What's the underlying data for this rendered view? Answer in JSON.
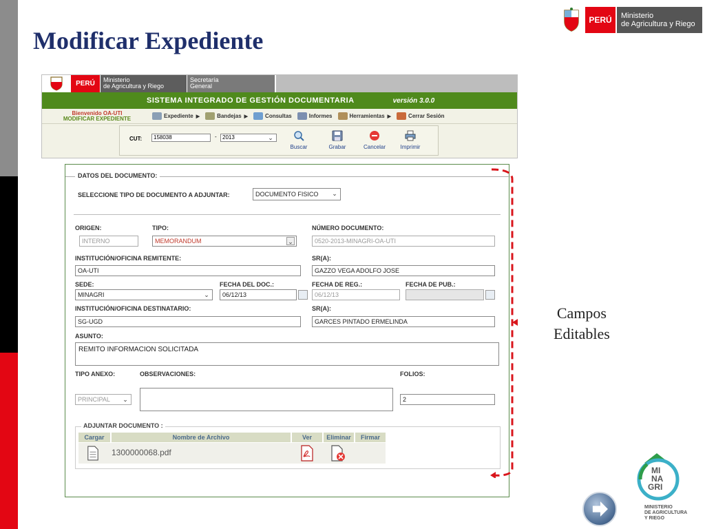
{
  "slide": {
    "title": "Modificar Expediente",
    "annotation": [
      "Campos",
      "Editables"
    ]
  },
  "brand": {
    "peru": "PERÚ",
    "ministry_line1": "Ministerio",
    "ministry_line2": "de Agricultura y Riego"
  },
  "app": {
    "peru": "PERÚ",
    "ministry_line1": "Ministerio",
    "ministry_line2": "de Agricultura y Riego",
    "secretaria_line1": "Secretaría",
    "secretaria_line2": "General",
    "system_title": "SISTEMA INTEGRADO DE GESTIÓN DOCUMENTARIA",
    "version": "versión 3.0.0",
    "welcome": "Bienvenido OA-UTI",
    "section": "Modificar Expediente",
    "menu": [
      "Expediente",
      "Bandejas",
      "Consultas",
      "Informes",
      "Herramientas",
      "Cerrar Sesión"
    ],
    "cut_label": "CUT:",
    "cut_value": "158038",
    "year_value": "2013",
    "dash": "-",
    "tools": [
      "Buscar",
      "Grabar",
      "Cancelar",
      "Imprimir"
    ]
  },
  "form": {
    "legend": "DATOS DEL DOCUMENTO:",
    "tipo_doc_label": "SELECCIONE TIPO DE DOCUMENTO A ADJUNTAR:",
    "tipo_doc_value": "DOCUMENTO FISICO",
    "origen_label": "ORIGEN:",
    "origen_value": "INTERNO",
    "tipo_label": "TIPO:",
    "tipo_value": "MEMORANDUM",
    "numero_label": "NÚMERO DOCUMENTO:",
    "numero_value": "0520-2013-MINAGRI-OA-UTI",
    "remitente_label": "INSTITUCIÓN/OFICINA REMITENTE:",
    "remitente_value": "OA-UTI",
    "sr1_label": "SR(A):",
    "sr1_value": "GAZZO VEGA ADOLFO JOSE",
    "sede_label": "SEDE:",
    "sede_value": "MINAGRI",
    "fecha_doc_label": "FECHA DEL DOC.:",
    "fecha_doc_value": "06/12/13",
    "fecha_reg_label": "FECHA DE REG.:",
    "fecha_reg_value": "06/12/13",
    "fecha_pub_label": "FECHA DE PUB.:",
    "destinatario_label": "INSTITUCIÓN/OFICINA DESTINATARIO:",
    "destinatario_value": "SG-UGD",
    "sr2_label": "SR(A):",
    "sr2_value": "GARCES PINTADO ERMELINDA",
    "asunto_label": "ASUNTO:",
    "asunto_value": "REMITO INFORMACION SOLICITADA",
    "anexo_label": "TIPO ANEXO:",
    "anexo_value": "PRINCIPAL",
    "obs_label": "OBSERVACIONES:",
    "folios_label": "FOLIOS:",
    "folios_value": "2",
    "adjuntar_legend": "ADJUNTAR DOCUMENTO :",
    "cols": [
      "Cargar",
      "Nombre de Archivo",
      "Ver",
      "Eliminar",
      "Firmar"
    ],
    "file_name": "1300000068.pdf"
  },
  "footer": {
    "logo_line1": "MI",
    "logo_line2": "NA",
    "logo_line3": "GRI",
    "logo_text1": "MINISTERIO",
    "logo_text2": "DE AGRICULTURA",
    "logo_text3": "Y RIEGO"
  },
  "colors": {
    "title": "#1f2f6b",
    "peru_red": "#e30613",
    "app_green": "#4f8a1c",
    "annotation_red": "#d9161c"
  }
}
